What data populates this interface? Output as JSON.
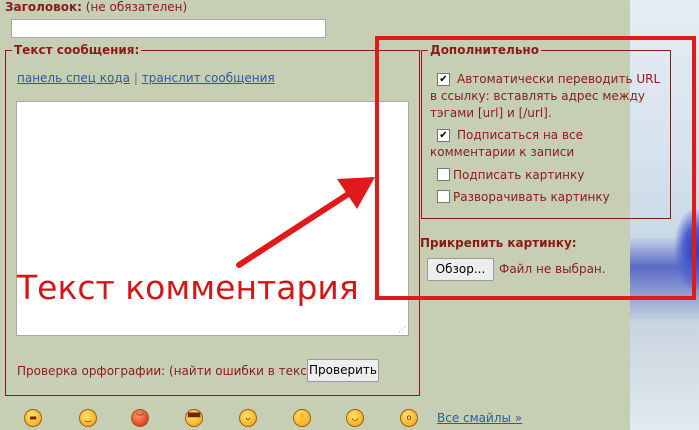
{
  "title_field": {
    "label": "Заголовок:",
    "hint": "(не обязателен)",
    "value": ""
  },
  "message": {
    "legend": "Текст сообщения:",
    "links": [
      "панель спец кода",
      "транслит сообщения"
    ],
    "separator": "|",
    "text": "",
    "spellcheck_text": "Проверка орфографии: (найти ошибки в тексте)",
    "check_button": "Проверить"
  },
  "extra": {
    "legend": "Дополнительно",
    "options": [
      {
        "label": "Автоматически переводить URL в ссылку: вставлять адрес между тэгами [url] и [/url].",
        "checked": true
      },
      {
        "label": "Подписаться на все комментарии к записи",
        "checked": true
      },
      {
        "label": "Подписать картинку",
        "checked": false
      },
      {
        "label": "Разворачивать картинку",
        "checked": false
      }
    ]
  },
  "attach": {
    "label": "Прикрепить картинку:",
    "browse_button": "Обзор...",
    "status": "Файл не выбран."
  },
  "smileys": {
    "icons": [
      "grin-teeth-smiley-icon",
      "smile-smiley-icon",
      "angry-smiley-icon",
      "sunglasses-smiley-icon",
      "tongue-smiley-icon",
      "wave-smiley-icon",
      "happy-smiley-icon",
      "surprised-smiley-icon"
    ],
    "all_link": "Все смайлы »"
  },
  "annotation": {
    "text": "Текст комментария",
    "color": "#e01a1a"
  },
  "colors": {
    "label": "#8b1a1a",
    "link": "#2b5aa0",
    "background": "#c6cfb3"
  }
}
